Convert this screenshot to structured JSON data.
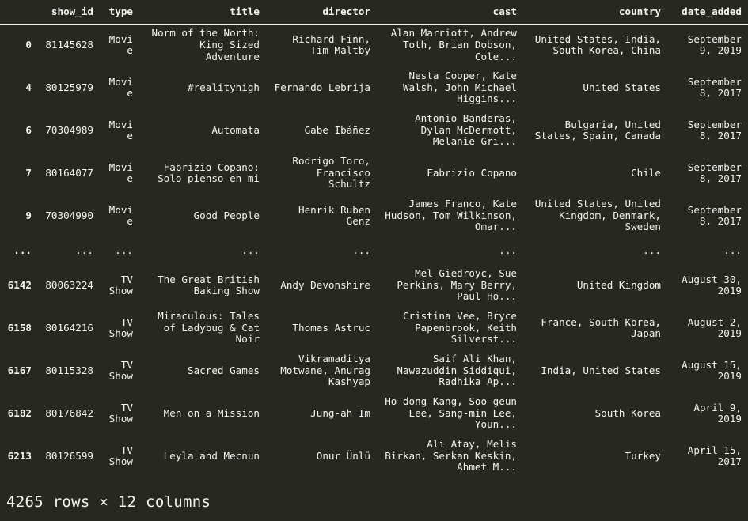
{
  "output": {
    "type": "pandas-dataframe-repr",
    "background_color": "#272822",
    "text_color": "#f5f5f0",
    "columns": [
      "show_id",
      "type",
      "title",
      "director",
      "cast",
      "country",
      "date_added"
    ],
    "index_header": "",
    "rows": [
      {
        "index": "0",
        "show_id": "81145628",
        "type": "Movie",
        "title": "Norm of the North: King Sized Adventure",
        "director": "Richard Finn, Tim Maltby",
        "cast": "Alan Marriott, Andrew Toth, Brian Dobson, Cole...",
        "country": "United States, India, South Korea, China",
        "date_added": "September 9, 2019"
      },
      {
        "index": "4",
        "show_id": "80125979",
        "type": "Movie",
        "title": "#realityhigh",
        "director": "Fernando Lebrija",
        "cast": "Nesta Cooper, Kate Walsh, John Michael Higgins...",
        "country": "United States",
        "date_added": "September 8, 2017"
      },
      {
        "index": "6",
        "show_id": "70304989",
        "type": "Movie",
        "title": "Automata",
        "director": "Gabe Ibáñez",
        "cast": "Antonio Banderas, Dylan McDermott, Melanie Gri...",
        "country": "Bulgaria, United States, Spain, Canada",
        "date_added": "September 8, 2017"
      },
      {
        "index": "7",
        "show_id": "80164077",
        "type": "Movie",
        "title": "Fabrizio Copano: Solo pienso en mi",
        "director": "Rodrigo Toro, Francisco Schultz",
        "cast": "Fabrizio Copano",
        "country": "Chile",
        "date_added": "September 8, 2017"
      },
      {
        "index": "9",
        "show_id": "70304990",
        "type": "Movie",
        "title": "Good People",
        "director": "Henrik Ruben Genz",
        "cast": "James Franco, Kate Hudson, Tom Wilkinson, Omar...",
        "country": "United States, United Kingdom, Denmark, Sweden",
        "date_added": "September 8, 2017"
      },
      {
        "index": "...",
        "show_id": "...",
        "type": "...",
        "title": "...",
        "director": "...",
        "cast": "...",
        "country": "...",
        "date_added": "..."
      },
      {
        "index": "6142",
        "show_id": "80063224",
        "type": "TV Show",
        "title": "The Great British Baking Show",
        "director": "Andy Devonshire",
        "cast": "Mel Giedroyc, Sue Perkins, Mary Berry, Paul Ho...",
        "country": "United Kingdom",
        "date_added": "August 30, 2019"
      },
      {
        "index": "6158",
        "show_id": "80164216",
        "type": "TV Show",
        "title": "Miraculous: Tales of Ladybug & Cat Noir",
        "director": "Thomas Astruc",
        "cast": "Cristina Vee, Bryce Papenbrook, Keith Silverst...",
        "country": "France, South Korea, Japan",
        "date_added": "August 2, 2019"
      },
      {
        "index": "6167",
        "show_id": "80115328",
        "type": "TV Show",
        "title": "Sacred Games",
        "director": "Vikramaditya Motwane, Anurag Kashyap",
        "cast": "Saif Ali Khan, Nawazuddin Siddiqui, Radhika Ap...",
        "country": "India, United States",
        "date_added": "August 15, 2019"
      },
      {
        "index": "6182",
        "show_id": "80176842",
        "type": "TV Show",
        "title": "Men on a Mission",
        "director": "Jung-ah Im",
        "cast": "Ho-dong Kang, Soo-geun Lee, Sang-min Lee, Youn...",
        "country": "South Korea",
        "date_added": "April 9, 2019"
      },
      {
        "index": "6213",
        "show_id": "80126599",
        "type": "TV Show",
        "title": "Leyla and Mecnun",
        "director": "Onur Ünlü",
        "cast": "Ali Atay, Melis Birkan, Serkan Keskin, Ahmet M...",
        "country": "Turkey",
        "date_added": "April 15, 2017"
      }
    ],
    "shape_summary": "4265 rows × 12 columns"
  }
}
